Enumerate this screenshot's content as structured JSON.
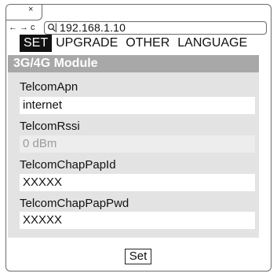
{
  "browser": {
    "tab_close_glyph": "×",
    "back_glyph": "←",
    "forward_glyph": "→",
    "reload_glyph": "c",
    "url": "192.168.1.10"
  },
  "menu": {
    "items": [
      {
        "label": "SET",
        "active": true
      },
      {
        "label": "UPGRADE",
        "active": false
      },
      {
        "label": "OTHER",
        "active": false
      },
      {
        "label": "LANGUAGE",
        "active": false
      }
    ]
  },
  "panel": {
    "title": "3G/4G Module",
    "fields": [
      {
        "label": "TelcomApn",
        "value": "internet",
        "disabled": false
      },
      {
        "label": "TelcomRssi",
        "value": "0 dBm",
        "disabled": true
      },
      {
        "label": "TelcomChapPapId",
        "value": "XXXXX",
        "disabled": false
      },
      {
        "label": "TelcomChapPapPwd",
        "value": "XXXXX",
        "disabled": false
      }
    ]
  },
  "actions": {
    "set_label": "Set"
  },
  "colors": {
    "active_menu_bg": "#111111",
    "panel_bg": "#e3e3e3",
    "panel_title_bg": "#a8a8a8"
  }
}
